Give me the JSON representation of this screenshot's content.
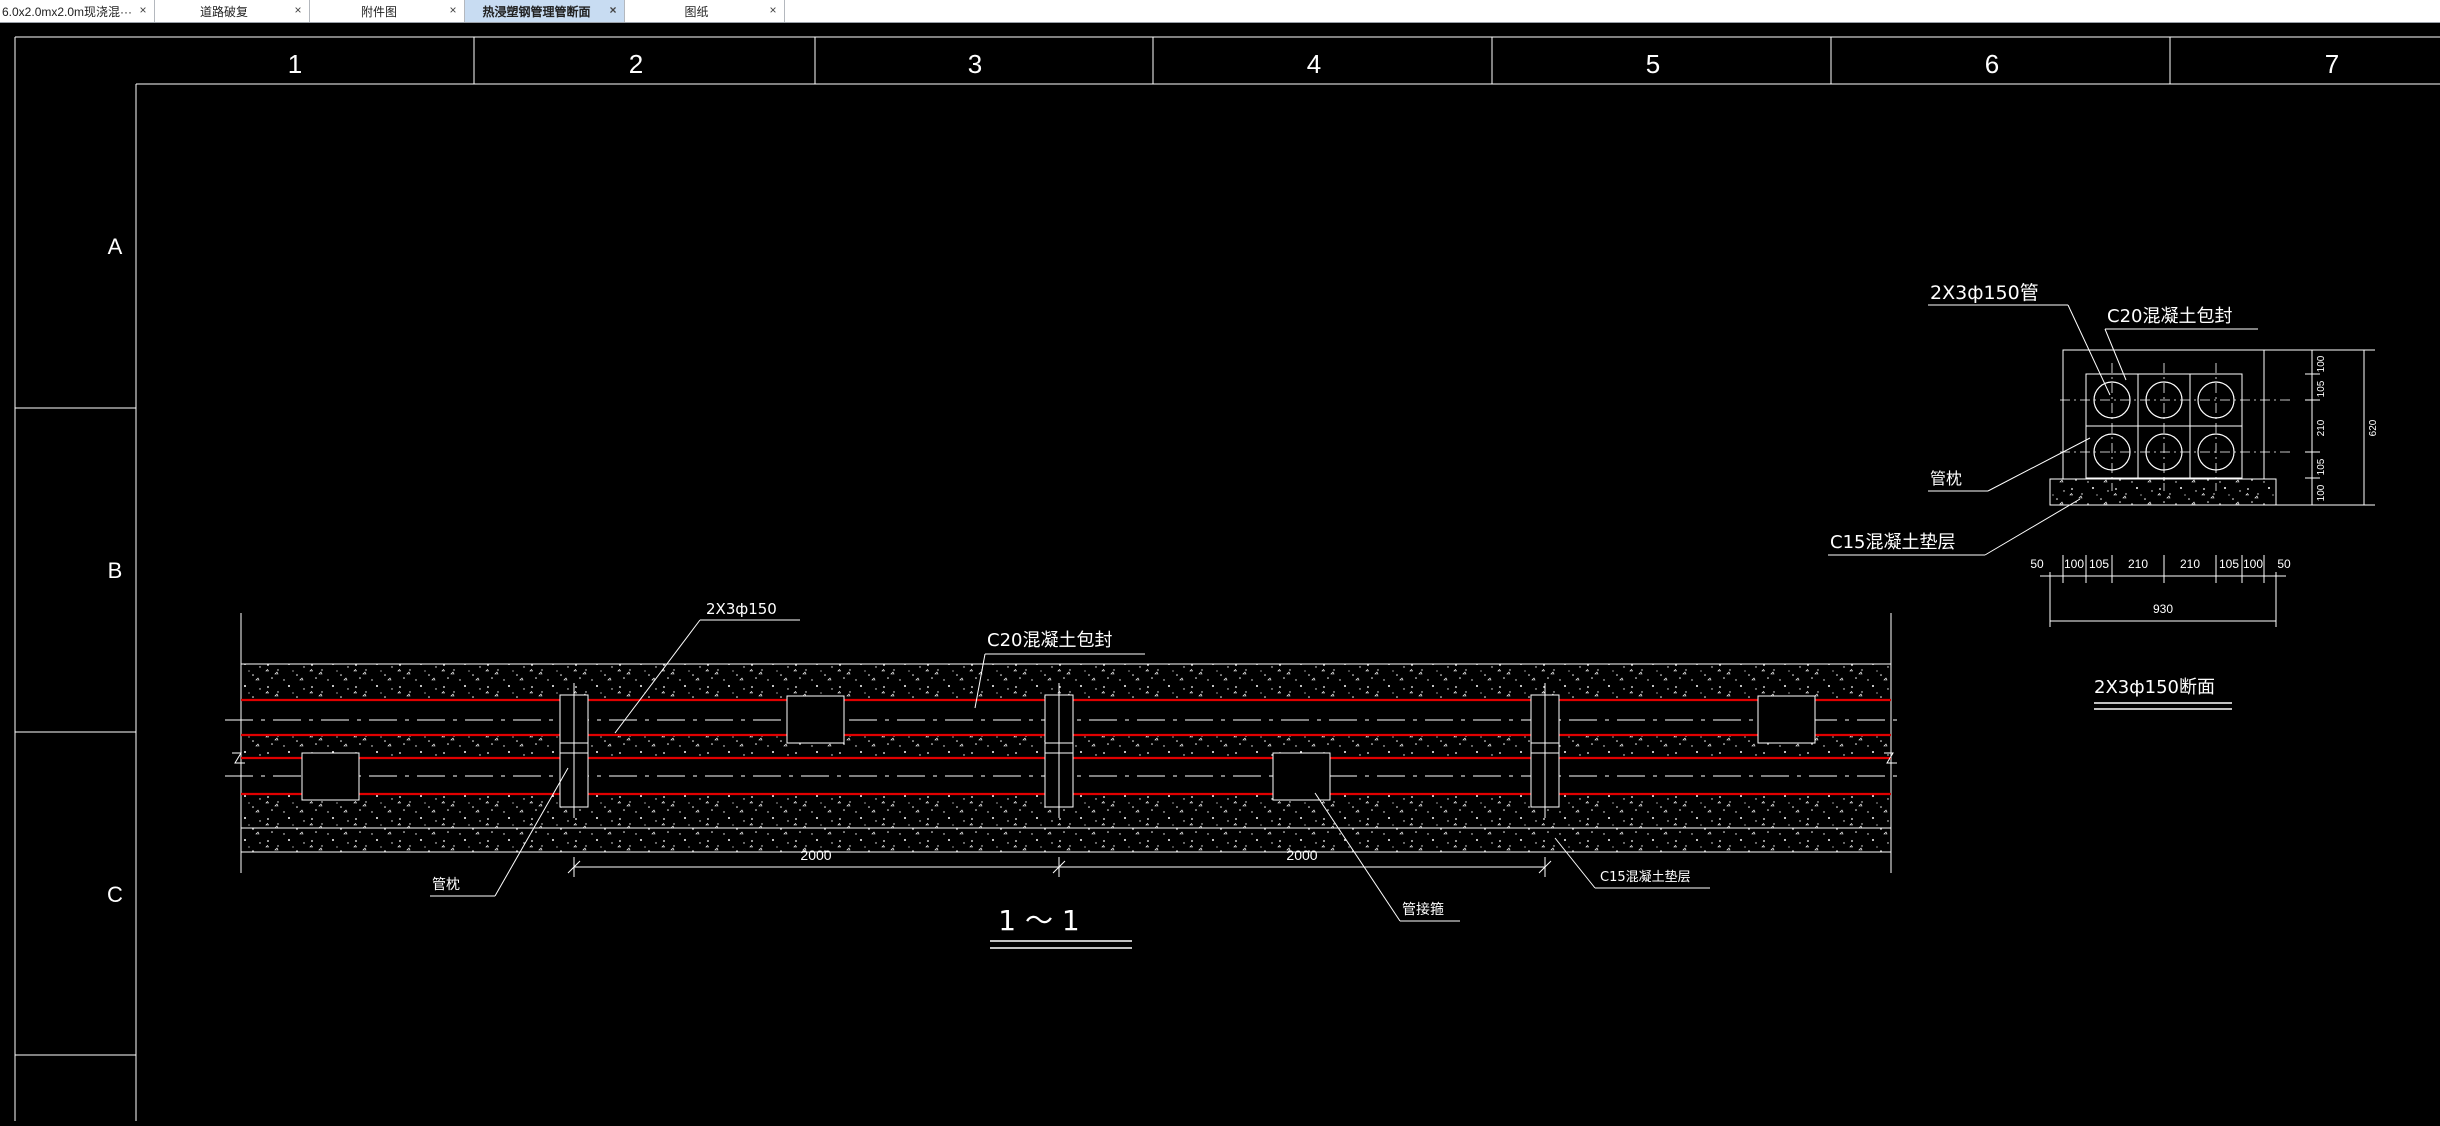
{
  "tabs": [
    {
      "label": "6.0x2.0mx2.0m现浇混···",
      "active": false,
      "close": "×"
    },
    {
      "label": "道路破复",
      "active": false,
      "close": "×"
    },
    {
      "label": "附件图",
      "active": false,
      "close": "×"
    },
    {
      "label": "热浸塑钢管理管断面",
      "active": true,
      "close": "×"
    },
    {
      "label": "图纸",
      "active": false,
      "close": "×"
    }
  ],
  "grid": {
    "columns": [
      "1",
      "2",
      "3",
      "4",
      "5",
      "6",
      "7"
    ],
    "rows": [
      "A",
      "B",
      "C"
    ]
  },
  "longitudinal": {
    "pipe_label": "2X3ф150",
    "encasement_label": "C20混凝土包封",
    "pipe_pillow_label": "管枕",
    "joint_label": "管接箍",
    "cushion_label": "C15混凝土垫层",
    "dim_left": "2000",
    "dim_right": "2000",
    "section_title": "1 ～ 1"
  },
  "cross_section": {
    "pipe_label": "2X3ф150管",
    "encasement_label": "C20混凝土包封",
    "pipe_pillow_label": "管枕",
    "cushion_label": "C15混凝土垫层",
    "bottom_dims": [
      "50",
      "100",
      "105",
      "210",
      "210",
      "105",
      "100",
      "50"
    ],
    "total_width": "930",
    "side_dims": [
      "100",
      "105",
      "210",
      "105",
      "100"
    ],
    "total_height": "620",
    "title": "2X3ф150断面"
  },
  "colors": {
    "line": "#ffffff",
    "pipe_red": "#e00000",
    "background": "#000000",
    "tab_active": "#c8dcf2"
  }
}
